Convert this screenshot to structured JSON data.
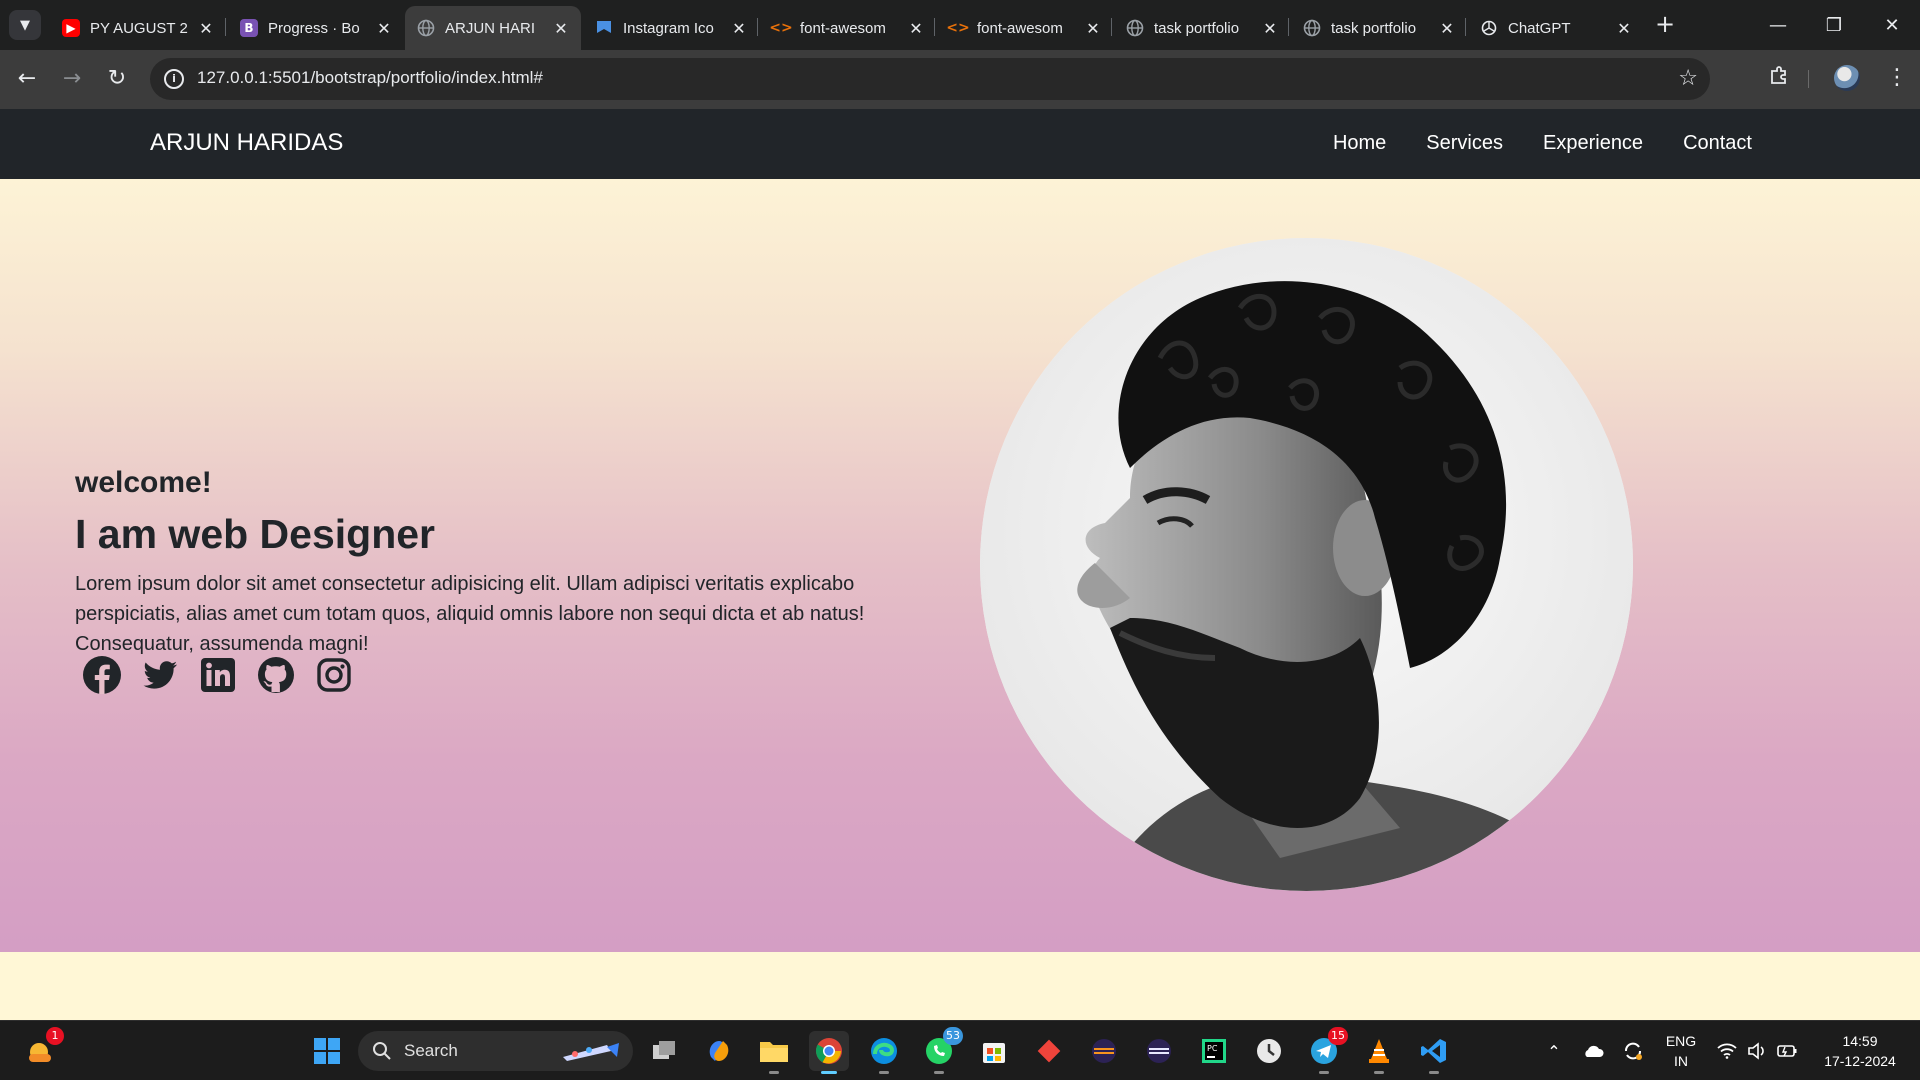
{
  "browser": {
    "tabs": [
      {
        "title": "PY AUGUST 2",
        "favicon": "youtube-icon",
        "color": "#ff0000"
      },
      {
        "title": "Progress · Bo",
        "favicon": "bootstrap-icon",
        "color": "#7952b3"
      },
      {
        "title": "ARJUN HARI",
        "favicon": "globe-icon",
        "color": "#9aa0a6",
        "active": true
      },
      {
        "title": "Instagram Ico",
        "favicon": "flag-icon",
        "color": "#1a73e8"
      },
      {
        "title": "font-awesom",
        "favicon": "code-icon",
        "color": "#e8710a"
      },
      {
        "title": "font-awesom",
        "favicon": "code-icon",
        "color": "#e8710a"
      },
      {
        "title": "task portfolio",
        "favicon": "globe-icon",
        "color": "#9aa0a6"
      },
      {
        "title": "task portfolio",
        "favicon": "globe-icon",
        "color": "#9aa0a6"
      },
      {
        "title": "ChatGPT",
        "favicon": "chatgpt-icon",
        "color": "#e8eaed"
      }
    ],
    "url": "127.0.0.1:5501/bootstrap/portfolio/index.html#"
  },
  "site": {
    "brand": "ARJUN HARIDAS",
    "nav": [
      "Home",
      "Services",
      "Experience",
      "Contact"
    ],
    "hero": {
      "welcome": "welcome!",
      "headline": "I am web Designer",
      "lead": "Lorem ipsum dolor sit amet consectetur adipisicing elit. Ullam adipisci veritatis explicabo perspiciatis, alias amet cum totam quos, aliquid omnis labore non sequi dicta et ab natus! Consequatur, assumenda magni!",
      "socials": [
        "facebook-icon",
        "twitter-icon",
        "linkedin-icon",
        "github-icon",
        "instagram-icon"
      ]
    }
  },
  "taskbar": {
    "search_label": "Search",
    "weather_badge": "1",
    "whatsapp_badge": "53",
    "telegram_badge": "15",
    "lang_line1": "ENG",
    "lang_line2": "IN",
    "time": "14:59",
    "date": "17-12-2024"
  },
  "colors": {
    "navbar": "#212529",
    "hero_top": "#fdf3d6",
    "hero_bottom": "#d49ec4"
  }
}
